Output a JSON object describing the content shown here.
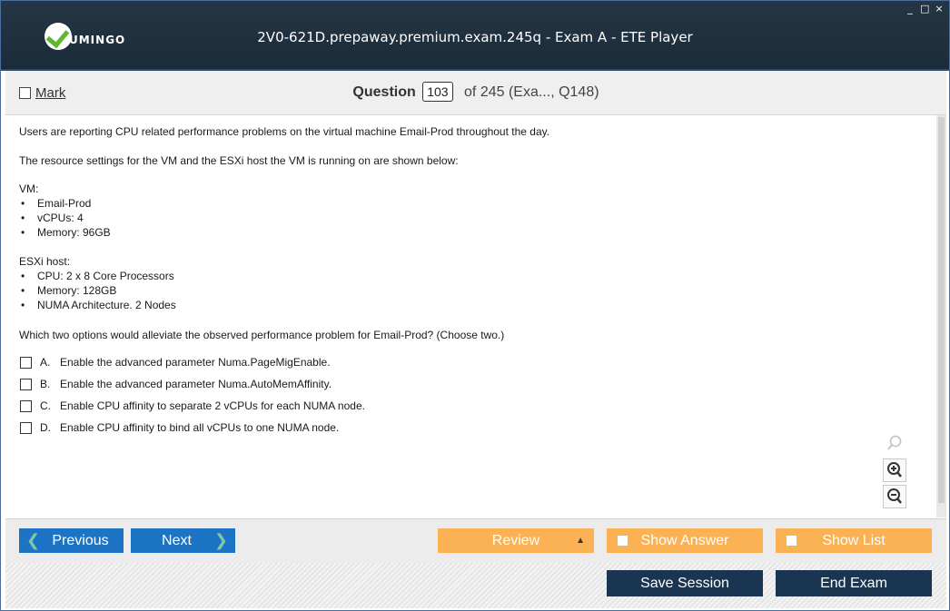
{
  "window": {
    "title": "2V0-621D.prepaway.premium.exam.245q - Exam A - ETE Player",
    "logo_text": "UMINGO",
    "controls": [
      "_",
      "□",
      "×"
    ]
  },
  "toolbar": {
    "mark_label": "Mark",
    "question_label": "Question",
    "question_number": "103",
    "question_of": "of 245 (Exa..., Q148)"
  },
  "question": {
    "intro1": "Users are reporting CPU related performance problems on the virtual machine Email-Prod throughout the day.",
    "intro2": "The resource settings for the VM and the ESXi host the VM is running on are shown below:",
    "vm_heading": "VM:",
    "vm_items": [
      "Email-Prod",
      "vCPUs: 4",
      "Memory: 96GB"
    ],
    "host_heading": "ESXi host:",
    "host_items": [
      "CPU: 2 x 8 Core Processors",
      "Memory: 128GB",
      "NUMA Architecture. 2 Nodes"
    ],
    "prompt": "Which two options would alleviate the observed performance problem for Email-Prod? (Choose two.)",
    "options": [
      {
        "letter": "A.",
        "text": "Enable the advanced parameter Numa.PageMigEnable."
      },
      {
        "letter": "B.",
        "text": "Enable the advanced parameter Numa.AutoMemAffinity."
      },
      {
        "letter": "C.",
        "text": "Enable CPU affinity to separate 2 vCPUs for each NUMA node."
      },
      {
        "letter": "D.",
        "text": "Enable CPU affinity to bind all vCPUs to one NUMA node."
      }
    ]
  },
  "zoom_icons": [
    "search-icon",
    "zoom-in-icon",
    "zoom-out-icon"
  ],
  "nav": {
    "previous_label": "Previous",
    "next_label": "Next",
    "review_label": "Review",
    "show_answer_label": "Show Answer",
    "show_list_label": "Show List"
  },
  "session": {
    "save_label": "Save Session",
    "end_label": "End Exam"
  },
  "colors": {
    "titlebar": "#1b2c3b",
    "nav_blue": "#1e74c4",
    "accent_orange": "#fab255",
    "dark_button": "#1a3552"
  }
}
